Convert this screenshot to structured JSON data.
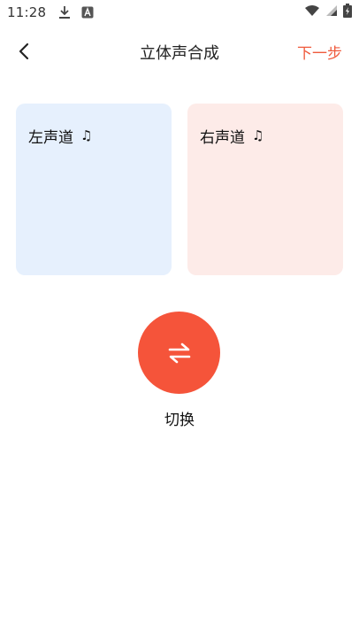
{
  "status_bar": {
    "time": "11:28"
  },
  "app_bar": {
    "title": "立体声合成",
    "next_label": "下一步"
  },
  "channels": {
    "left_label": "左声道",
    "right_label": "右声道",
    "note_symbol": "♫"
  },
  "switch": {
    "label": "切换",
    "symbol": "⇋"
  },
  "colors": {
    "accent": "#f5543a",
    "next_text": "#ef5a3c",
    "left_card": "#e6f0fd",
    "right_card": "#fdebe8"
  }
}
